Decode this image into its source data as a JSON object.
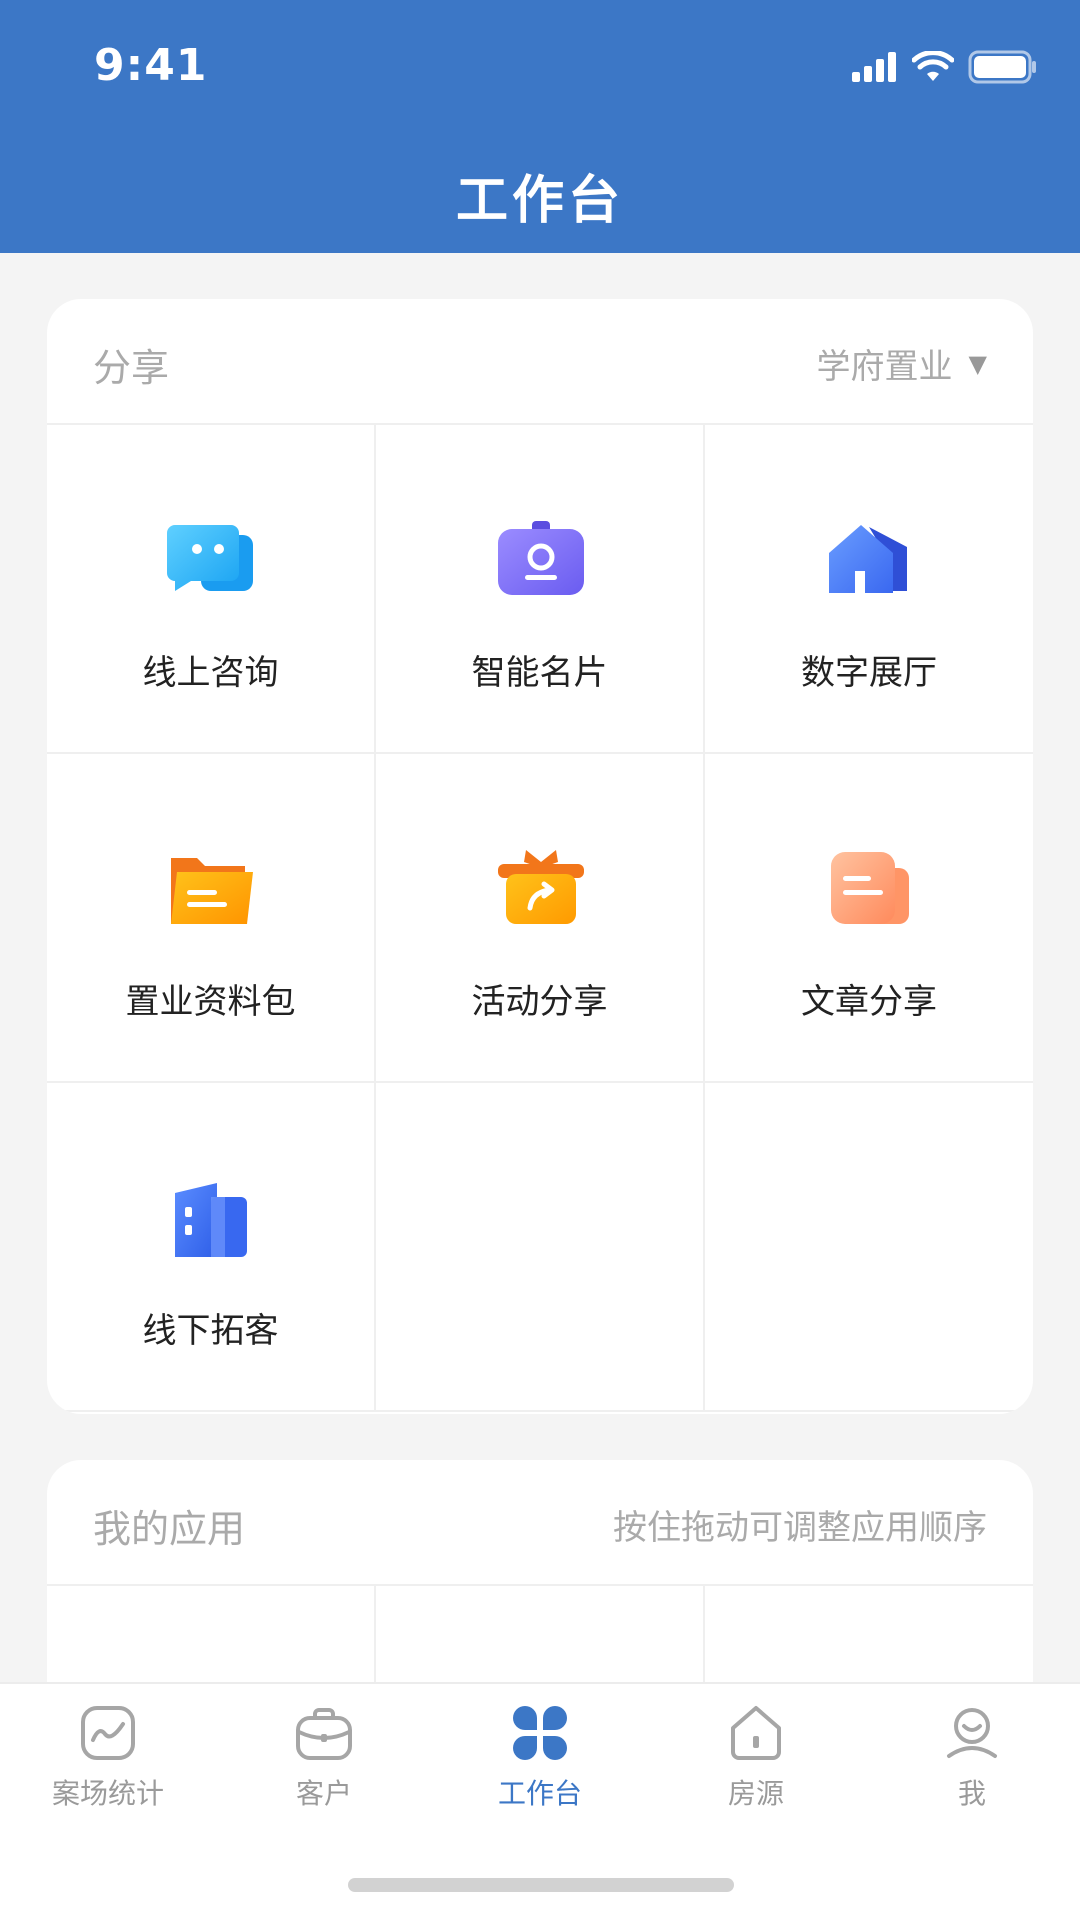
{
  "status": {
    "time": "9:41"
  },
  "header": {
    "title": "工作台"
  },
  "share": {
    "title": "分享",
    "selector": "学府置业",
    "items": [
      {
        "label": "线上咨询",
        "icon": "chat-bubbles-icon"
      },
      {
        "label": "智能名片",
        "icon": "id-badge-icon"
      },
      {
        "label": "数字展厅",
        "icon": "house-icon"
      },
      {
        "label": "置业资料包",
        "icon": "folder-icon"
      },
      {
        "label": "活动分享",
        "icon": "gift-share-icon"
      },
      {
        "label": "文章分享",
        "icon": "document-icon"
      },
      {
        "label": "线下拓客",
        "icon": "building-icon"
      }
    ]
  },
  "apps": {
    "title": "我的应用",
    "hint": "按住拖动可调整应用顺序"
  },
  "tabbar": {
    "items": [
      {
        "label": "案场统计",
        "icon": "stats-icon"
      },
      {
        "label": "客户",
        "icon": "customer-bag-icon"
      },
      {
        "label": "工作台",
        "icon": "grid-icon",
        "active": true
      },
      {
        "label": "房源",
        "icon": "home-icon"
      },
      {
        "label": "我",
        "icon": "profile-icon"
      }
    ]
  },
  "colors": {
    "primary": "#3c77c6",
    "background": "#f4f4f4"
  }
}
